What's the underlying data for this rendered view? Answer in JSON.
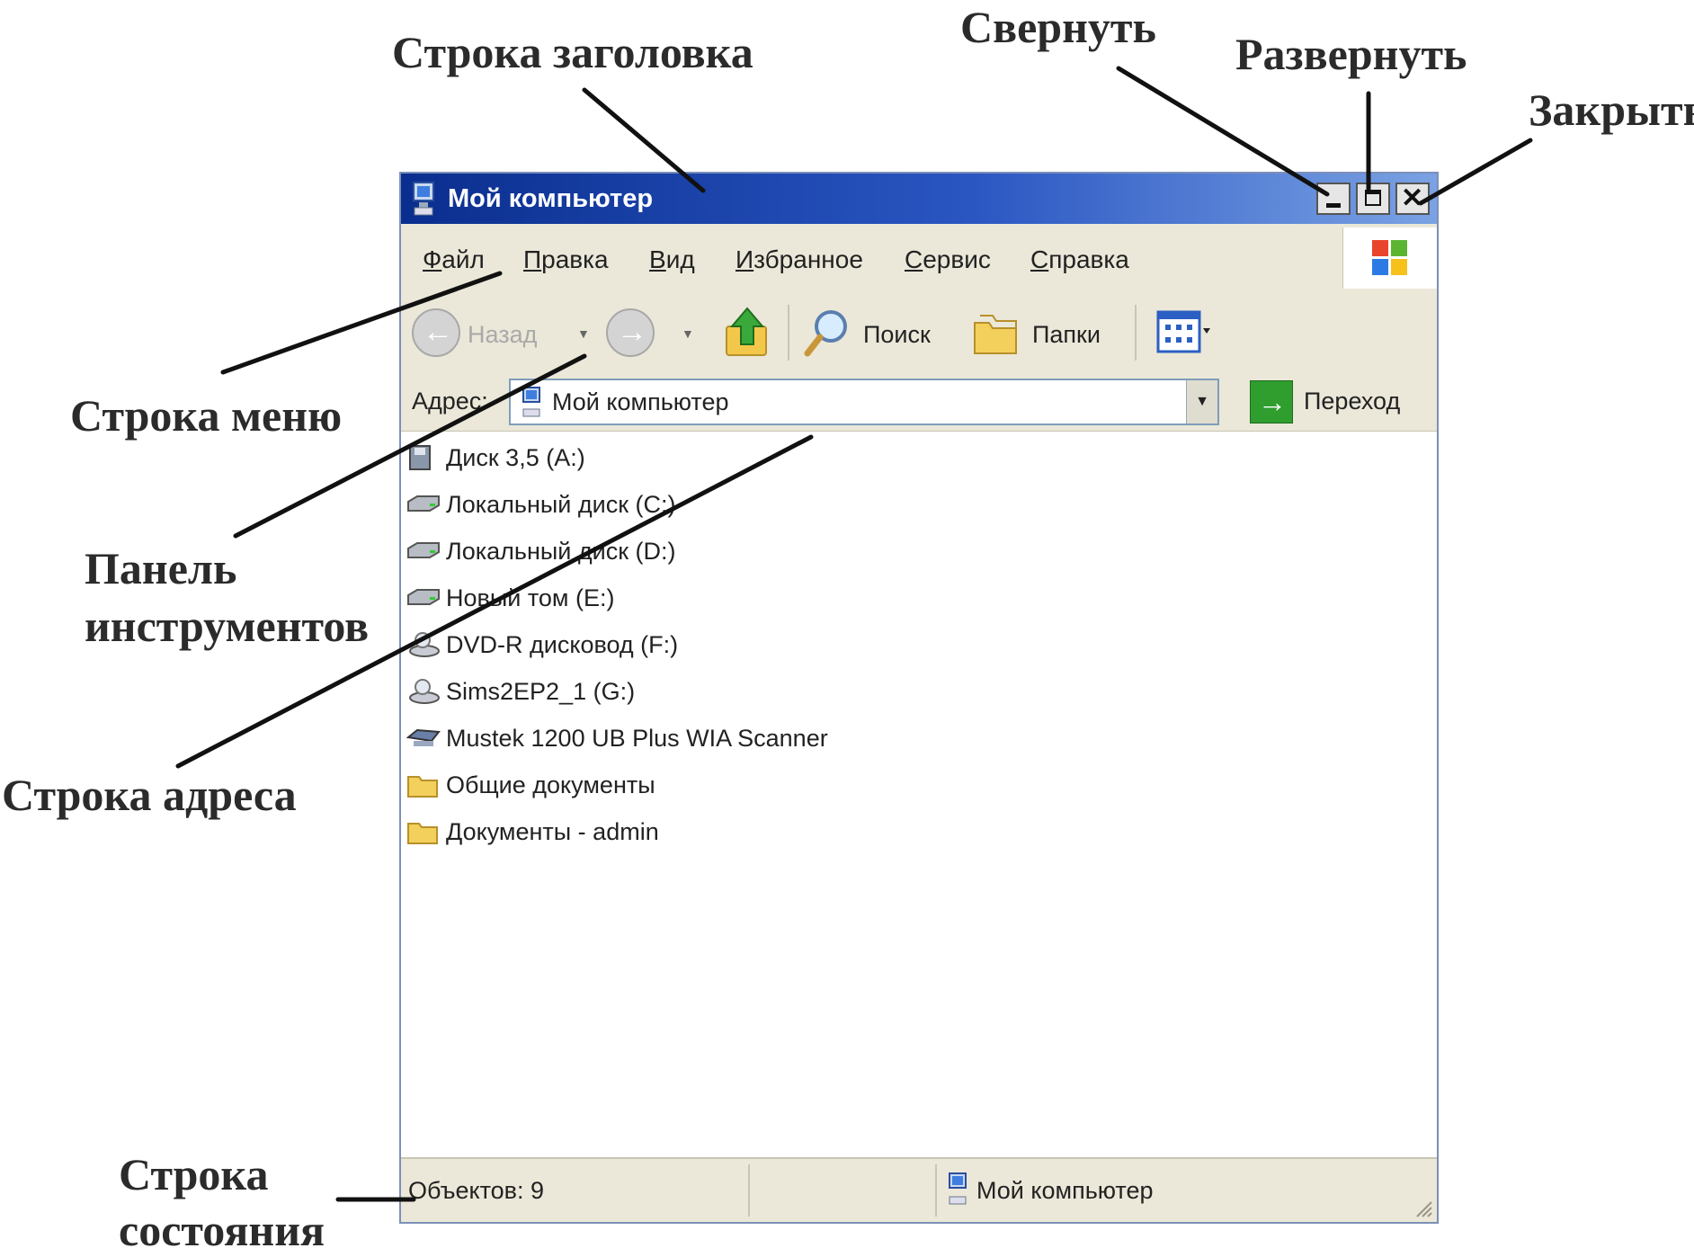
{
  "callouts": {
    "title_bar": "Строка заголовка",
    "minimize": "Свернуть",
    "maximize": "Развернуть",
    "close": "Закрыть",
    "menu_bar": "Строка меню",
    "toolbar": [
      "Панель",
      "инструментов"
    ],
    "address_bar": "Строка адреса",
    "status_bar": [
      "Строка",
      "состояния"
    ]
  },
  "window": {
    "title": "Мой компьютер",
    "menu": [
      "Файл",
      "Правка",
      "Вид",
      "Избранное",
      "Сервис",
      "Справка"
    ],
    "toolbar": {
      "back_label": "Назад",
      "search_label": "Поиск",
      "folders_label": "Папки"
    },
    "address": {
      "label": "Адрес:",
      "value": "Мой компьютер",
      "go_label": "Переход"
    },
    "items": [
      {
        "label": "Диск 3,5 (A:)",
        "icon": "floppy-drive-icon"
      },
      {
        "label": "Локальный диск (C:)",
        "icon": "hard-drive-icon"
      },
      {
        "label": "Локальный диск (D:)",
        "icon": "hard-drive-icon"
      },
      {
        "label": "Новый том (E:)",
        "icon": "hard-drive-icon"
      },
      {
        "label": "DVD-R дисковод (F:)",
        "icon": "dvd-drive-icon"
      },
      {
        "label": "Sims2EP2_1 (G:)",
        "icon": "cd-drive-icon"
      },
      {
        "label": "Mustek 1200 UB Plus WIA Scanner",
        "icon": "scanner-icon"
      },
      {
        "label": "Общие документы",
        "icon": "folder-icon"
      },
      {
        "label": "Документы - admin",
        "icon": "folder-icon"
      }
    ],
    "status": {
      "count": "Объектов: 9",
      "location": "Мой компьютер"
    }
  },
  "colors": {
    "titlebar_start": "#0a2e8e",
    "titlebar_end": "#7aa2e4",
    "chrome": "#ebe8d9",
    "go_button": "#2f9e2f"
  }
}
